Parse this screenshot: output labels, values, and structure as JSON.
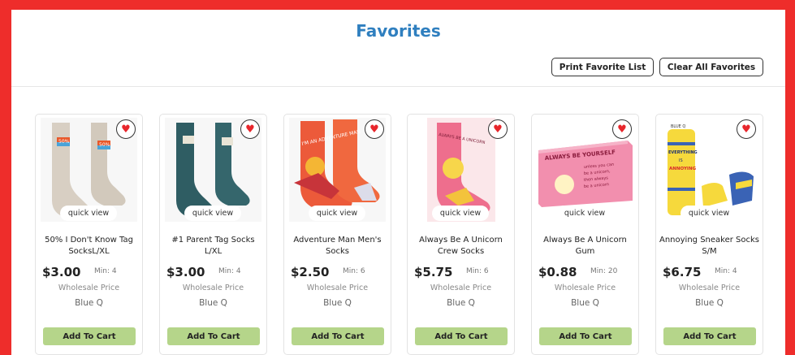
{
  "page": {
    "title": "Favorites",
    "print_label": "Print Favorite List",
    "clear_label": "Clear All Favorites"
  },
  "labels": {
    "quick_view": "quick view",
    "wholesale": "Wholesale Price",
    "add_to_cart": "Add To Cart"
  },
  "products": [
    {
      "name": "50% I Don't Know Tag SocksL/XL",
      "price": "$3.00",
      "min": "Min: 4",
      "brand": "Blue Q",
      "image_icon": "gray-socks-icon"
    },
    {
      "name": "#1 Parent Tag Socks L/XL",
      "price": "$3.00",
      "min": "Min: 4",
      "brand": "Blue Q",
      "image_icon": "teal-socks-icon"
    },
    {
      "name": "Adventure Man Men's Socks",
      "price": "$2.50",
      "min": "Min: 6",
      "brand": "Blue Q",
      "image_icon": "red-socks-icon"
    },
    {
      "name": "Always Be A Unicorn Crew Socks",
      "price": "$5.75",
      "min": "Min: 6",
      "brand": "Blue Q",
      "image_icon": "pink-sock-icon"
    },
    {
      "name": "Always Be A Unicorn Gum",
      "price": "$0.88",
      "min": "Min: 20",
      "brand": "Blue Q",
      "image_icon": "gum-box-icon"
    },
    {
      "name": "Annoying Sneaker Socks S/M",
      "price": "$6.75",
      "min": "Min: 4",
      "brand": "Blue Q",
      "image_icon": "yellow-socks-icon"
    }
  ],
  "image_text": {
    "p1_tag_a": "50%",
    "p1_tag_b": "50%",
    "p3_text": "I'M AN ADVENTURE MAN",
    "p4_text": "ALWAYS BE A UNICORN",
    "p5_line1": "ALWAYS BE YOURSELF",
    "p5_line2": "unless you can",
    "p5_line3": "be a unicorn,",
    "p5_line4": "then always",
    "p5_line5": "be a unicorn",
    "p6_line1": "EVERYTHING",
    "p6_line2": "IS",
    "p6_line3": "ANNOYING",
    "p6_top": "BLUE Q"
  },
  "colors": {
    "brand_red": "#ee2d2b",
    "title_blue": "#2f7fbf",
    "cart_green": "#b5d58a",
    "heart_red": "#e8262c"
  }
}
